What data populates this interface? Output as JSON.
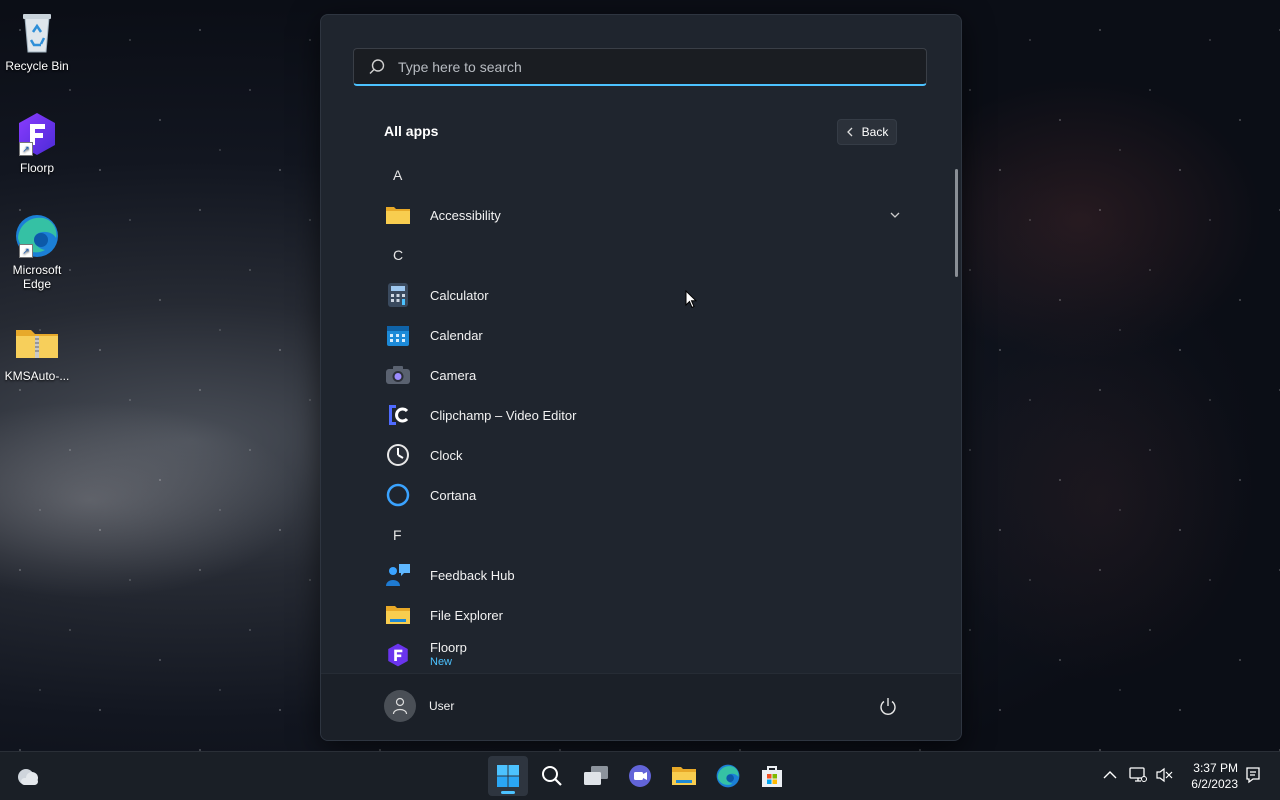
{
  "desktop": {
    "icons": [
      {
        "label": "Recycle Bin"
      },
      {
        "label": "Floorp"
      },
      {
        "label": "Microsoft Edge"
      },
      {
        "label": "KMSAuto-..."
      }
    ]
  },
  "start_menu": {
    "search": {
      "placeholder": "Type here to search",
      "value": ""
    },
    "title": "All apps",
    "back_label": "Back",
    "groups": [
      {
        "letter": "A",
        "apps": [
          {
            "name": "Accessibility",
            "icon": "folder-icon",
            "expandable": true
          }
        ]
      },
      {
        "letter": "C",
        "apps": [
          {
            "name": "Calculator",
            "icon": "calculator-icon"
          },
          {
            "name": "Calendar",
            "icon": "calendar-icon"
          },
          {
            "name": "Camera",
            "icon": "camera-icon"
          },
          {
            "name": "Clipchamp – Video Editor",
            "icon": "clipchamp-icon"
          },
          {
            "name": "Clock",
            "icon": "clock-icon"
          },
          {
            "name": "Cortana",
            "icon": "cortana-icon"
          }
        ]
      },
      {
        "letter": "F",
        "apps": [
          {
            "name": "Feedback Hub",
            "icon": "feedback-hub-icon"
          },
          {
            "name": "File Explorer",
            "icon": "file-explorer-icon"
          },
          {
            "name": "Floorp",
            "icon": "floorp-icon",
            "badge": "New"
          }
        ]
      }
    ],
    "user": {
      "name": "User"
    }
  },
  "taskbar": {
    "pinned": [
      "start-icon",
      "search-icon",
      "task-view-icon",
      "teams-chat-icon",
      "file-explorer-icon",
      "edge-icon",
      "store-icon"
    ],
    "clock": {
      "time": "3:37 PM",
      "date": "6/2/2023"
    }
  },
  "colors": {
    "accent": "#4cc2ff",
    "menu_bg": "#1f252e",
    "taskbar_bg": "#1a1f26"
  }
}
